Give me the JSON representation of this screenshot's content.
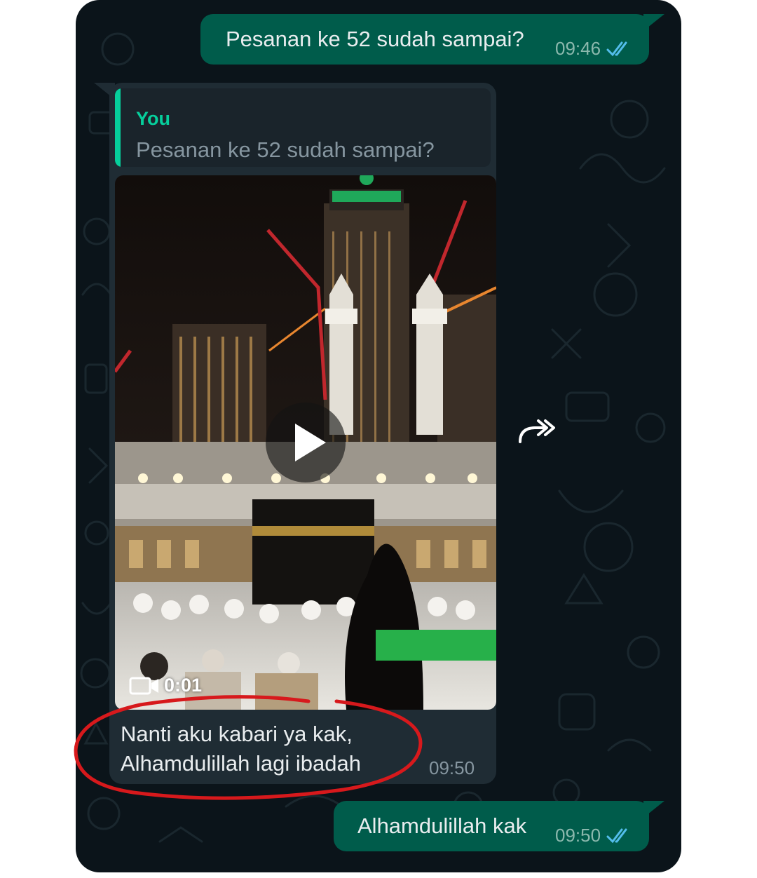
{
  "theme": {
    "chat_background": "#0b141a",
    "outgoing_bubble": "#005c4b",
    "incoming_bubble": "#1f2c34",
    "quote_accent": "#06cf9c",
    "read_ticks": "#53bdeb",
    "annotation_circle": "#d7191c"
  },
  "messages": {
    "out1": {
      "text": "Pesanan ke 52 sudah sampai?",
      "time": "09:46",
      "status": "read",
      "status_icon": "double-check-icon"
    },
    "in1": {
      "quote": {
        "author": "You",
        "text": "Pesanan ke 52 sudah sampai?"
      },
      "video": {
        "duration": "0:01",
        "icons": [
          "play-icon",
          "video-camera-icon"
        ]
      },
      "caption": [
        "Nanti aku kabari ya kak,",
        "Alhamdulillah lagi ibadah"
      ],
      "time": "09:50",
      "action_icon": "forward-icon"
    },
    "out2": {
      "text": "Alhamdulillah kak",
      "time": "09:50",
      "status": "read",
      "status_icon": "double-check-icon"
    }
  }
}
